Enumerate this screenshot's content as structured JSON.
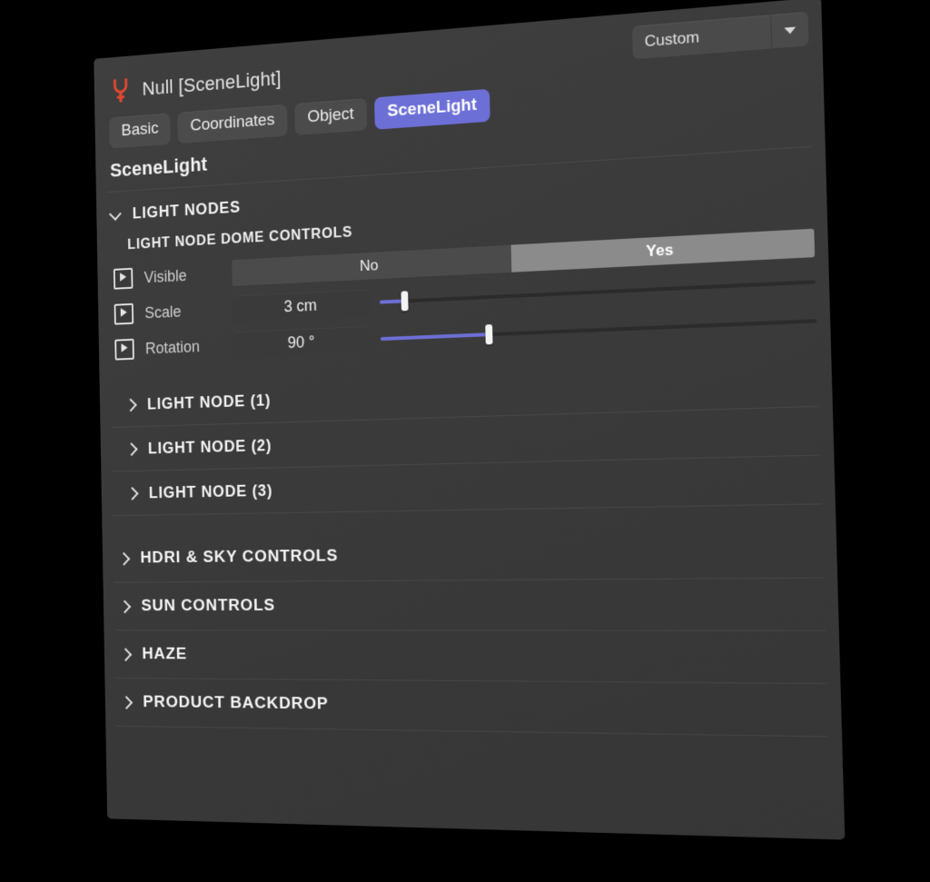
{
  "window": {
    "object_icon": "plug-icon",
    "title": "Null [SceneLight]",
    "accent_color": "#6c6fd6",
    "icon_color": "#e0492f",
    "panel_bg": "#3b3b3b"
  },
  "preset": {
    "value": "Custom",
    "caret_icon": "chevron-down-icon"
  },
  "tabs": [
    {
      "label": "Basic",
      "active": false
    },
    {
      "label": "Coordinates",
      "active": false
    },
    {
      "label": "Object",
      "active": false
    },
    {
      "label": "SceneLight",
      "active": true
    }
  ],
  "page_title": "SceneLight",
  "light_nodes": {
    "header": "LIGHT NODES",
    "expanded": true,
    "chevron_icon": "chevron-down-icon",
    "subheader": "LIGHT NODE DOME CONTROLS",
    "params": [
      {
        "type": "toggle",
        "track_icon": "animation-track-icon",
        "label": "Visible",
        "options": [
          "No",
          "Yes"
        ],
        "value": "Yes"
      },
      {
        "type": "slider",
        "track_icon": "animation-track-icon",
        "label": "Scale",
        "value": "3 cm",
        "percent": 6
      },
      {
        "type": "slider",
        "track_icon": "animation-track-icon",
        "label": "Rotation",
        "value": "90 °",
        "percent": 26
      }
    ],
    "nodes": [
      {
        "label": "LIGHT NODE (1)",
        "expanded": false,
        "chevron_icon": "chevron-right-icon"
      },
      {
        "label": "LIGHT NODE (2)",
        "expanded": false,
        "chevron_icon": "chevron-right-icon"
      },
      {
        "label": "LIGHT NODE (3)",
        "expanded": false,
        "chevron_icon": "chevron-right-icon"
      }
    ]
  },
  "sections": [
    {
      "label": "HDRI & SKY CONTROLS",
      "expanded": false,
      "chevron_icon": "chevron-right-icon"
    },
    {
      "label": "SUN CONTROLS",
      "expanded": false,
      "chevron_icon": "chevron-right-icon"
    },
    {
      "label": "HAZE",
      "expanded": false,
      "chevron_icon": "chevron-right-icon"
    },
    {
      "label": "PRODUCT BACKDROP",
      "expanded": false,
      "chevron_icon": "chevron-right-icon"
    }
  ]
}
